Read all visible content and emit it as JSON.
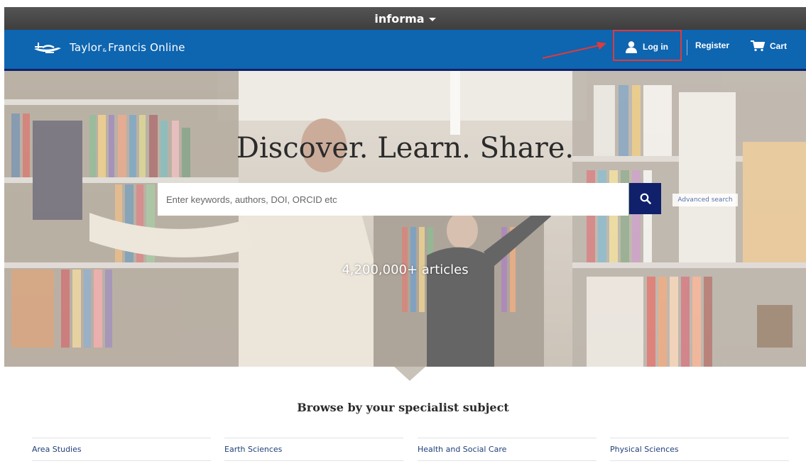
{
  "informa": {
    "label": "informa"
  },
  "header": {
    "brand": "Taylor & Francis Online",
    "brand_parts": {
      "a": "Taylor",
      "amp": "&",
      "b": "Francis Online"
    },
    "login": "Log in",
    "register": "Register",
    "cart": "Cart"
  },
  "hero": {
    "title": "Discover. Learn. Share.",
    "search_placeholder": "Enter keywords, authors, DOI, ORCID etc",
    "advanced_search": "Advanced search",
    "articles": "4,200,000+ articles"
  },
  "browse": {
    "heading": "Browse by your specialist subject",
    "subjects": [
      "Area Studies",
      "Earth Sciences",
      "Health and Social Care",
      "Physical Sciences"
    ]
  },
  "colors": {
    "header_blue": "#0e65b0",
    "navy": "#10206b",
    "annotation_red": "#e03a3a"
  }
}
